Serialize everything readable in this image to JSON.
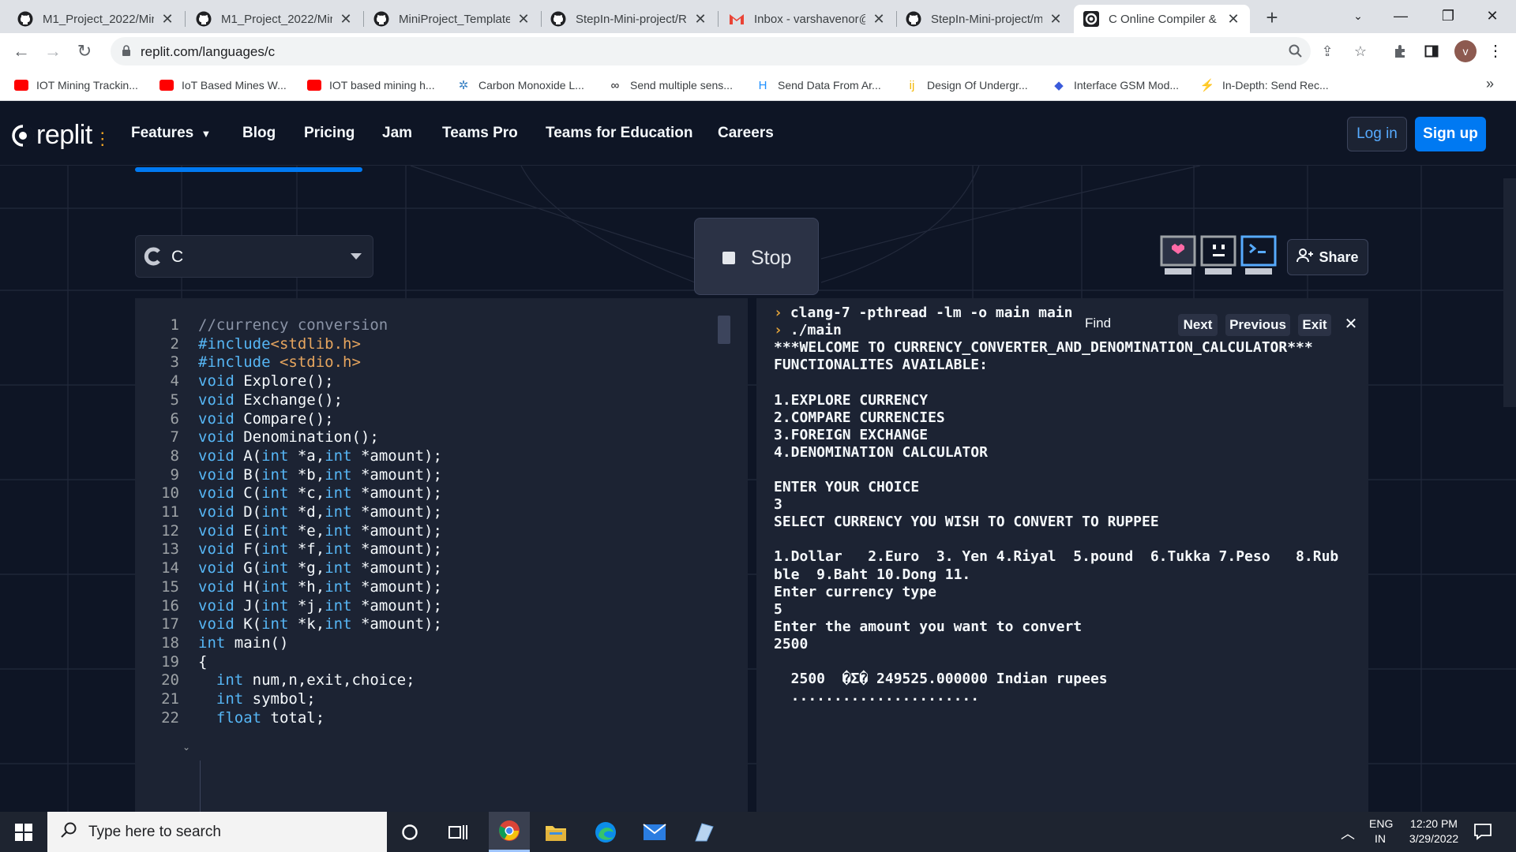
{
  "browser": {
    "tabs": [
      {
        "title": "M1_Project_2022/Min",
        "icon": "github-icon",
        "active": false
      },
      {
        "title": "M1_Project_2022/Min",
        "icon": "github-icon",
        "active": false
      },
      {
        "title": "MiniProject_Template",
        "icon": "github-icon",
        "active": false
      },
      {
        "title": "StepIn-Mini-project/R",
        "icon": "github-icon",
        "active": false
      },
      {
        "title": "Inbox - varshavenor@",
        "icon": "gmail-icon",
        "active": false
      },
      {
        "title": "StepIn-Mini-project/m",
        "icon": "github-icon",
        "active": false
      },
      {
        "title": "C Online Compiler &",
        "icon": "replit-icon",
        "active": true
      }
    ],
    "close_glyph": "✕",
    "new_tab_glyph": "+",
    "url": "replit.com/languages/c",
    "profile_initial": "v",
    "bookmarks": [
      {
        "label": "IOT Mining Trackin...",
        "icon": "youtube-icon",
        "color": "#ff0000"
      },
      {
        "label": "IoT Based Mines W...",
        "icon": "youtube-icon",
        "color": "#ff0000"
      },
      {
        "label": "IOT based mining h...",
        "icon": "youtube-icon",
        "color": "#ff0000"
      },
      {
        "label": "Carbon Monoxide L...",
        "icon": "gear-icon",
        "color": "#3b82c4"
      },
      {
        "label": "Send multiple sens...",
        "icon": "infinity-icon",
        "color": "#202124"
      },
      {
        "label": "Send Data From Ar...",
        "icon": "hackster-icon",
        "color": "#1e90ff"
      },
      {
        "label": "Design Of Undergr...",
        "icon": "ij-icon",
        "color": "#f2b705"
      },
      {
        "label": "Interface GSM Mod...",
        "icon": "diamond-icon",
        "color": "#3b5bdb"
      },
      {
        "label": "In-Depth: Send Rec...",
        "icon": "bolt-icon",
        "color": "#f08c00"
      }
    ],
    "bookmarks_more": "»"
  },
  "site": {
    "logo_text": "replit",
    "nav": [
      "Features",
      "Blog",
      "Pricing",
      "Jam",
      "Teams Pro",
      "Teams for Education",
      "Careers"
    ],
    "login_label": "Log in",
    "signup_label": "Sign up",
    "language": "C",
    "stop_label": "Stop",
    "share_label": "Share"
  },
  "editor": {
    "lines": [
      {
        "n": "1",
        "tokens": [
          {
            "t": "//currency conversion",
            "c": "cm"
          }
        ]
      },
      {
        "n": "2",
        "tokens": [
          {
            "t": "#include",
            "c": "kw"
          },
          {
            "t": "<stdlib.h>",
            "c": "str"
          }
        ]
      },
      {
        "n": "3",
        "tokens": [
          {
            "t": "#include ",
            "c": "kw"
          },
          {
            "t": "<stdio.h>",
            "c": "str"
          }
        ]
      },
      {
        "n": "4",
        "tokens": [
          {
            "t": "void",
            "c": "kw"
          },
          {
            "t": " Explore();",
            "c": ""
          }
        ]
      },
      {
        "n": "5",
        "tokens": [
          {
            "t": "void",
            "c": "kw"
          },
          {
            "t": " Exchange();",
            "c": ""
          }
        ]
      },
      {
        "n": "6",
        "tokens": [
          {
            "t": "void",
            "c": "kw"
          },
          {
            "t": " Compare();",
            "c": ""
          }
        ]
      },
      {
        "n": "7",
        "tokens": [
          {
            "t": "void",
            "c": "kw"
          },
          {
            "t": " Denomination();",
            "c": ""
          }
        ]
      },
      {
        "n": "8",
        "tokens": [
          {
            "t": "void",
            "c": "kw"
          },
          {
            "t": " A(",
            "c": ""
          },
          {
            "t": "int",
            "c": "kw"
          },
          {
            "t": " *a,",
            "c": ""
          },
          {
            "t": "int",
            "c": "kw"
          },
          {
            "t": " *amount);",
            "c": ""
          }
        ]
      },
      {
        "n": "9",
        "tokens": [
          {
            "t": "void",
            "c": "kw"
          },
          {
            "t": " B(",
            "c": ""
          },
          {
            "t": "int",
            "c": "kw"
          },
          {
            "t": " *b,",
            "c": ""
          },
          {
            "t": "int",
            "c": "kw"
          },
          {
            "t": " *amount);",
            "c": ""
          }
        ]
      },
      {
        "n": "10",
        "tokens": [
          {
            "t": "void",
            "c": "kw"
          },
          {
            "t": " C(",
            "c": ""
          },
          {
            "t": "int",
            "c": "kw"
          },
          {
            "t": " *c,",
            "c": ""
          },
          {
            "t": "int",
            "c": "kw"
          },
          {
            "t": " *amount);",
            "c": ""
          }
        ]
      },
      {
        "n": "11",
        "tokens": [
          {
            "t": "void",
            "c": "kw"
          },
          {
            "t": " D(",
            "c": ""
          },
          {
            "t": "int",
            "c": "kw"
          },
          {
            "t": " *d,",
            "c": ""
          },
          {
            "t": "int",
            "c": "kw"
          },
          {
            "t": " *amount);",
            "c": ""
          }
        ]
      },
      {
        "n": "12",
        "tokens": [
          {
            "t": "void",
            "c": "kw"
          },
          {
            "t": " E(",
            "c": ""
          },
          {
            "t": "int",
            "c": "kw"
          },
          {
            "t": " *e,",
            "c": ""
          },
          {
            "t": "int",
            "c": "kw"
          },
          {
            "t": " *amount);",
            "c": ""
          }
        ]
      },
      {
        "n": "13",
        "tokens": [
          {
            "t": "void",
            "c": "kw"
          },
          {
            "t": " F(",
            "c": ""
          },
          {
            "t": "int",
            "c": "kw"
          },
          {
            "t": " *f,",
            "c": ""
          },
          {
            "t": "int",
            "c": "kw"
          },
          {
            "t": " *amount);",
            "c": ""
          }
        ]
      },
      {
        "n": "14",
        "tokens": [
          {
            "t": "void",
            "c": "kw"
          },
          {
            "t": " G(",
            "c": ""
          },
          {
            "t": "int",
            "c": "kw"
          },
          {
            "t": " *g,",
            "c": ""
          },
          {
            "t": "int",
            "c": "kw"
          },
          {
            "t": " *amount);",
            "c": ""
          }
        ]
      },
      {
        "n": "15",
        "tokens": [
          {
            "t": "void",
            "c": "kw"
          },
          {
            "t": " H(",
            "c": ""
          },
          {
            "t": "int",
            "c": "kw"
          },
          {
            "t": " *h,",
            "c": ""
          },
          {
            "t": "int",
            "c": "kw"
          },
          {
            "t": " *amount);",
            "c": ""
          }
        ]
      },
      {
        "n": "16",
        "tokens": [
          {
            "t": "void",
            "c": "kw"
          },
          {
            "t": " J(",
            "c": ""
          },
          {
            "t": "int",
            "c": "kw"
          },
          {
            "t": " *j,",
            "c": ""
          },
          {
            "t": "int",
            "c": "kw"
          },
          {
            "t": " *amount);",
            "c": ""
          }
        ]
      },
      {
        "n": "17",
        "tokens": [
          {
            "t": "void",
            "c": "kw"
          },
          {
            "t": " K(",
            "c": ""
          },
          {
            "t": "int",
            "c": "kw"
          },
          {
            "t": " *k,",
            "c": ""
          },
          {
            "t": "int",
            "c": "kw"
          },
          {
            "t": " *amount);",
            "c": ""
          }
        ]
      },
      {
        "n": "18",
        "tokens": [
          {
            "t": "int",
            "c": "kw"
          },
          {
            "t": " main()",
            "c": ""
          }
        ]
      },
      {
        "n": "19",
        "tokens": [
          {
            "t": "{",
            "c": ""
          }
        ]
      },
      {
        "n": "20",
        "tokens": [
          {
            "t": "  ",
            "c": ""
          },
          {
            "t": "int",
            "c": "kw"
          },
          {
            "t": " num,n,exit,choice;",
            "c": ""
          }
        ]
      },
      {
        "n": "21",
        "tokens": [
          {
            "t": "  ",
            "c": ""
          },
          {
            "t": "int",
            "c": "kw"
          },
          {
            "t": " symbol;",
            "c": ""
          }
        ]
      },
      {
        "n": "22",
        "tokens": [
          {
            "t": "  ",
            "c": ""
          },
          {
            "t": "float",
            "c": "kw"
          },
          {
            "t": " total;",
            "c": ""
          }
        ]
      }
    ]
  },
  "console": {
    "lines": [
      {
        "prompt": "›",
        "text": "clang-7 -pthread -lm -o main main"
      },
      {
        "prompt": "›",
        "text": "./main"
      },
      {
        "prompt": "",
        "text": "***WELCOME TO CURRENCY_CONVERTER_AND_DENOMINATION_CALCULATOR***"
      },
      {
        "prompt": "",
        "text": "FUNCTIONALITES AVAILABLE:"
      },
      {
        "prompt": "",
        "text": ""
      },
      {
        "prompt": "",
        "text": "1.EXPLORE CURRENCY"
      },
      {
        "prompt": "",
        "text": "2.COMPARE CURRENCIES"
      },
      {
        "prompt": "",
        "text": "3.FOREIGN EXCHANGE"
      },
      {
        "prompt": "",
        "text": "4.DENOMINATION CALCULATOR"
      },
      {
        "prompt": "",
        "text": ""
      },
      {
        "prompt": "",
        "text": "ENTER YOUR CHOICE"
      },
      {
        "prompt": "",
        "text": "3"
      },
      {
        "prompt": "",
        "text": "SELECT CURRENCY YOU WISH TO CONVERT TO RUPPEE"
      },
      {
        "prompt": "",
        "text": ""
      },
      {
        "prompt": "",
        "text": "1.Dollar   2.Euro  3. Yen 4.Riyal  5.pound  6.Tukka 7.Peso   8.Rub"
      },
      {
        "prompt": "",
        "text": "ble  9.Baht 10.Dong 11."
      },
      {
        "prompt": "",
        "text": "Enter currency type"
      },
      {
        "prompt": "",
        "text": "5"
      },
      {
        "prompt": "",
        "text": "Enter the amount you want to convert"
      },
      {
        "prompt": "",
        "text": "2500"
      },
      {
        "prompt": "",
        "text": ""
      },
      {
        "prompt": "",
        "text": "  2500  �Σ� 249525.000000 Indian rupees"
      },
      {
        "prompt": "",
        "text": "  ......................"
      }
    ],
    "find": {
      "label": "Find",
      "next": "Next",
      "previous": "Previous",
      "exit": "Exit",
      "close": "✕"
    }
  },
  "taskbar": {
    "search_placeholder": "Type here to search",
    "lang_top": "ENG",
    "lang_bottom": "IN",
    "time": "12:20 PM",
    "date": "3/29/2022"
  }
}
